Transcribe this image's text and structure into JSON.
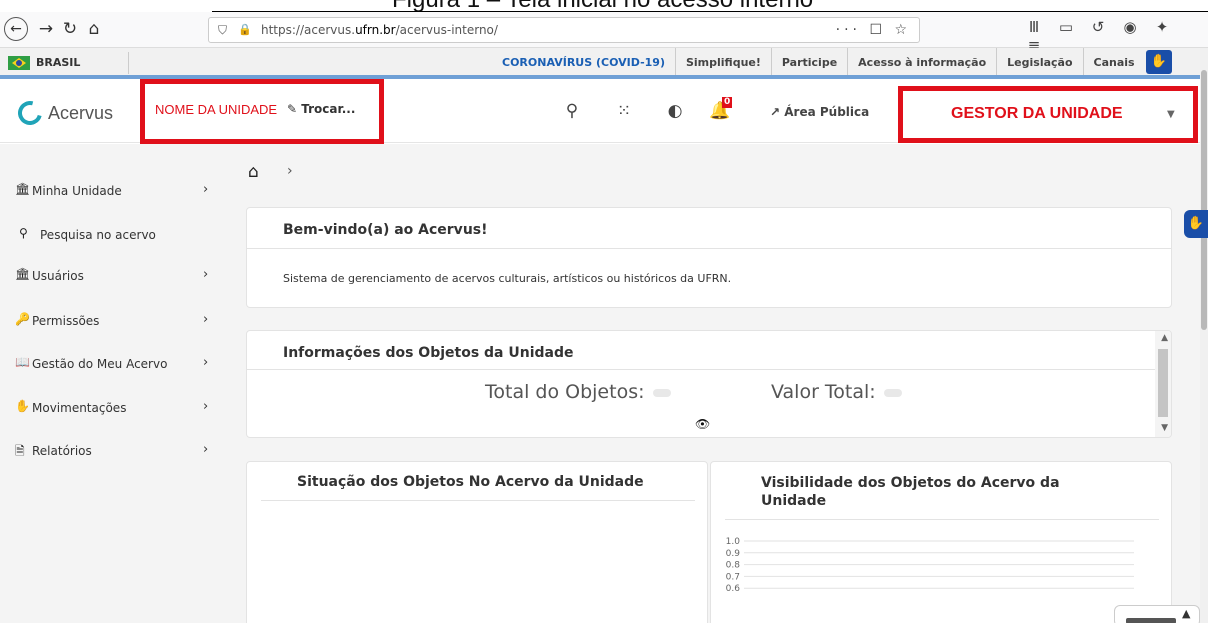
{
  "caption": {
    "text": "Figura 1 – Tela inicial no acesso interno"
  },
  "browser": {
    "url_prefix": "https://acervus.",
    "url_domain": "ufrn.br",
    "url_path": "/acervus-interno/",
    "url_actions": "··· ☐ ☆"
  },
  "gov_bar": {
    "country": "BRASIL",
    "links": [
      "CORONAVÍRUS (COVID-19)",
      "Simplifique!",
      "Participe",
      "Acesso à informação",
      "Legislação",
      "Canais"
    ]
  },
  "header": {
    "app_name": "Acervus",
    "unit_name": "NOME DA UNIDADE",
    "unit_switch": "Trocar...",
    "notification_count": "0",
    "public_area": "Área Pública",
    "role": "GESTOR DA UNIDADE"
  },
  "sidebar": {
    "items": [
      {
        "label": "Minha Unidade",
        "icon": "institution-icon",
        "has_children": true
      },
      {
        "label": "Pesquisa no acervo",
        "icon": "search-icon",
        "has_children": false
      },
      {
        "label": "Usuários",
        "icon": "institution-icon",
        "has_children": true
      },
      {
        "label": "Permissões",
        "icon": "key-icon",
        "has_children": true
      },
      {
        "label": "Gestão do Meu Acervo",
        "icon": "book-icon",
        "has_children": true
      },
      {
        "label": "Movimentações",
        "icon": "hand-box-icon",
        "has_children": true
      },
      {
        "label": "Relatórios",
        "icon": "file-icon",
        "has_children": true
      }
    ]
  },
  "welcome": {
    "title": "Bem-vindo(a) ao Acervus!",
    "text": "Sistema de gerenciamento de acervos culturais, artísticos ou históricos da UFRN."
  },
  "info": {
    "title": "Informações dos Objetos da Unidade",
    "total_label": "Total do Objetos:",
    "value_label": "Valor Total:"
  },
  "situation": {
    "title": "Situação dos Objetos No Acervo da Unidade"
  },
  "visibility": {
    "title": "Visibilidade dos Objetos do Acervo da Unidade"
  },
  "chart_data": {
    "type": "bar",
    "title": "",
    "y_ticks": [
      "1.0",
      "0.9",
      "0.8",
      "0.7",
      "0.6"
    ],
    "ylim": [
      0.6,
      1.0
    ],
    "grid": true
  },
  "colors": {
    "highlight": "#e0101a",
    "gov_accent": "#6fa0d6",
    "covid_link": "#1a5fb4",
    "logo": "#20a4b8",
    "vlibras": "#1a4ea8"
  }
}
